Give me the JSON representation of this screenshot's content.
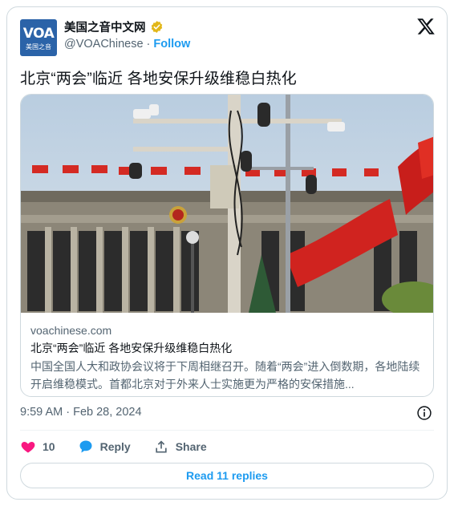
{
  "author": {
    "display_name": "美国之音中文网",
    "handle": "@VOAChinese",
    "separator": "·",
    "follow_label": "Follow",
    "avatar_text": "VOA",
    "avatar_subtext": "美国之音",
    "verified_color": "#e2b719"
  },
  "tweet": {
    "text": "北京“两会”临近 各地安保升级维稳白热化",
    "timestamp": "9:59 AM · Feb 28, 2024"
  },
  "link_card": {
    "domain": "voachinese.com",
    "title": "北京“两会”临近 各地安保升级维稳白热化",
    "description": "中国全国人大和政协会议将于下周相继召开。随着“两会”进入倒数期，各地陆续开启维稳模式。首都北京对于外来人士实施更为严格的安保措施...",
    "image_icon": "photo-tiananmen-cameras-flags"
  },
  "actions": {
    "like_count": "10",
    "reply_label": "Reply",
    "share_label": "Share"
  },
  "replies_button": "Read 11 replies",
  "colors": {
    "accent": "#1d9bf0",
    "like": "#f91880",
    "secondary_text": "#536471",
    "border": "#cfd9de"
  }
}
